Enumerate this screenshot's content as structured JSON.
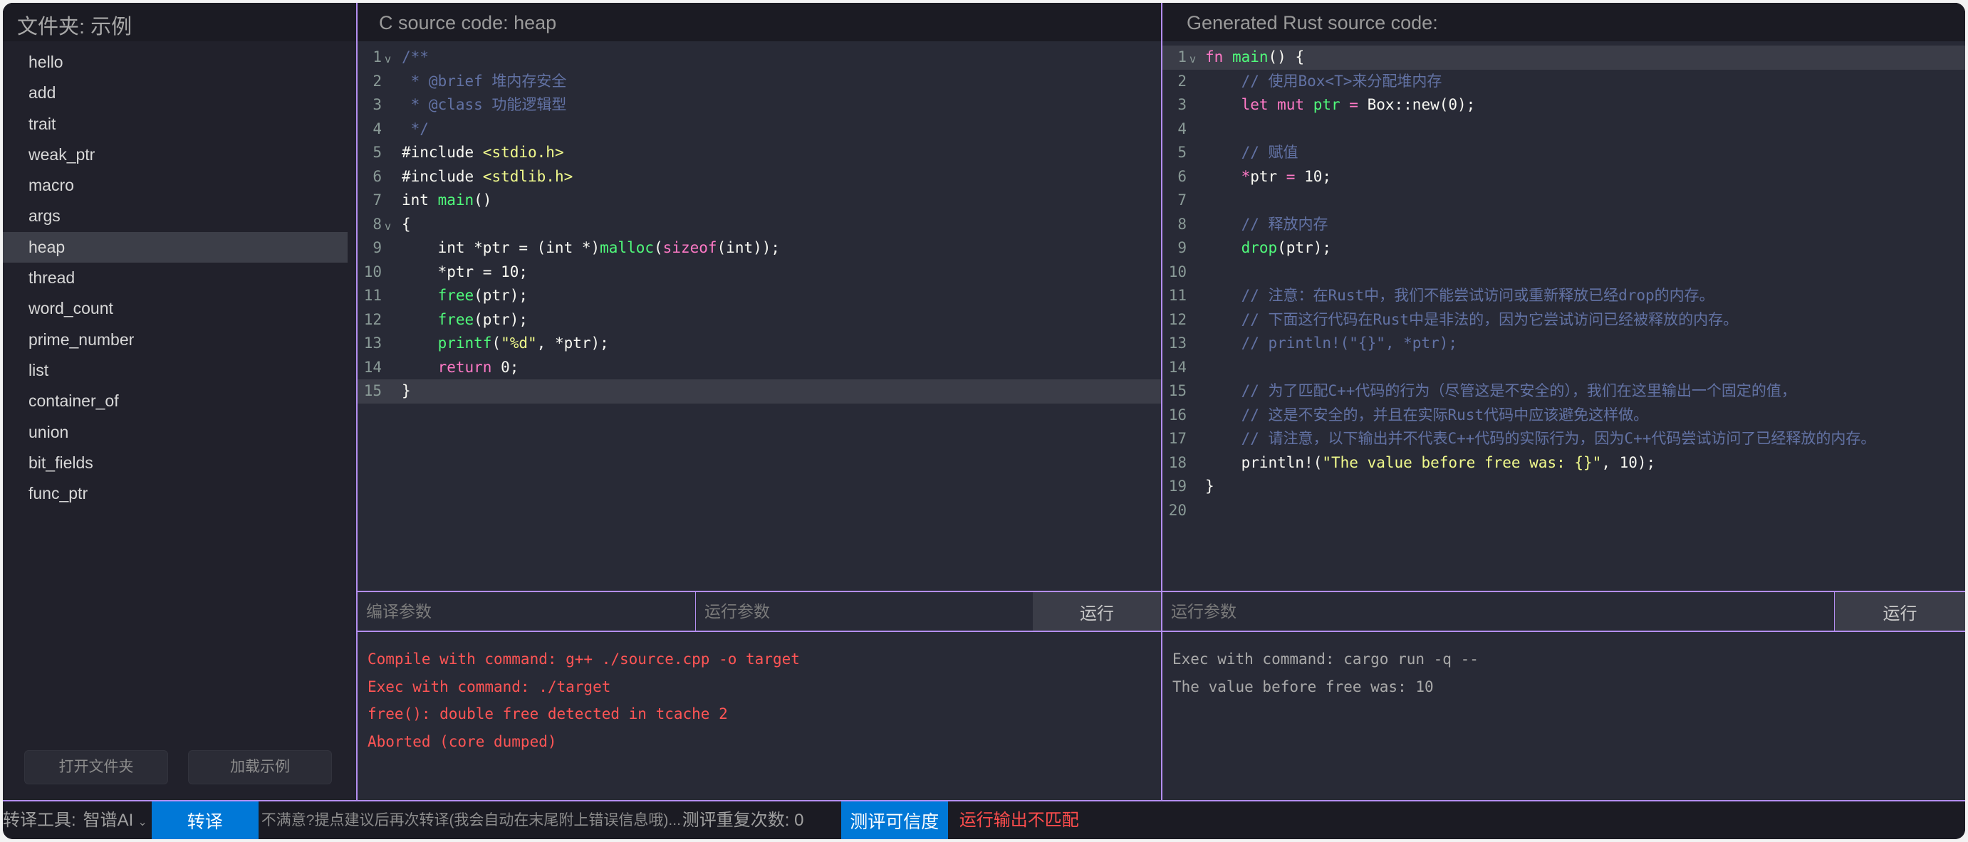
{
  "sidebar": {
    "title": "文件夹: 示例",
    "items": [
      {
        "label": "hello"
      },
      {
        "label": "add"
      },
      {
        "label": "trait"
      },
      {
        "label": "weak_ptr"
      },
      {
        "label": "macro"
      },
      {
        "label": "args"
      },
      {
        "label": "heap",
        "active": true
      },
      {
        "label": "thread"
      },
      {
        "label": "word_count"
      },
      {
        "label": "prime_number"
      },
      {
        "label": "list"
      },
      {
        "label": "container_of"
      },
      {
        "label": "union"
      },
      {
        "label": "bit_fields"
      },
      {
        "label": "func_ptr"
      }
    ],
    "open_folder_label": "打开文件夹",
    "load_example_label": "加载示例"
  },
  "c_panel": {
    "title": "C source code: heap",
    "lines": [
      [
        [
          "cm",
          "/**"
        ]
      ],
      [
        [
          "cm",
          " * @brief 堆内存安全"
        ]
      ],
      [
        [
          "cm",
          " * @class 功能逻辑型"
        ]
      ],
      [
        [
          "cm",
          " */"
        ]
      ],
      [
        [
          "",
          "#include "
        ],
        [
          "st",
          "<stdio.h>"
        ]
      ],
      [
        [
          "",
          "#include "
        ],
        [
          "st",
          "<stdlib.h>"
        ]
      ],
      [
        [
          "",
          "int "
        ],
        [
          "fn",
          "main"
        ],
        [
          "",
          "()"
        ]
      ],
      [
        [
          "",
          "{"
        ]
      ],
      [
        [
          "",
          "    int *ptr = (int *)"
        ],
        [
          "fn",
          "malloc"
        ],
        [
          "",
          "("
        ],
        [
          "kw",
          "sizeof"
        ],
        [
          "",
          "(int));"
        ]
      ],
      [
        [
          "",
          "    *ptr = 10;"
        ]
      ],
      [
        [
          "",
          "    "
        ],
        [
          "fn",
          "free"
        ],
        [
          "",
          "(ptr);"
        ]
      ],
      [
        [
          "",
          "    "
        ],
        [
          "fn",
          "free"
        ],
        [
          "",
          "(ptr);"
        ]
      ],
      [
        [
          "",
          "    "
        ],
        [
          "fn",
          "printf"
        ],
        [
          "",
          "("
        ],
        [
          "st",
          "\"%d\""
        ],
        [
          "",
          ", *ptr);"
        ]
      ],
      [
        [
          "",
          "    "
        ],
        [
          "kw",
          "return"
        ],
        [
          "",
          " 0;"
        ]
      ],
      [
        [
          "",
          "}"
        ]
      ]
    ],
    "fold_lines": [
      1,
      8
    ],
    "highlight_line": 15,
    "compile_params_placeholder": "编译参数",
    "run_params_placeholder": "运行参数",
    "run_label": "运行",
    "output": [
      "Compile with command: g++ ./source.cpp -o target",
      "Exec with command: ./target",
      "free(): double free detected in tcache 2",
      "Aborted (core dumped)"
    ],
    "output_status": "error"
  },
  "rust_panel": {
    "title": "Generated Rust source code:",
    "lines": [
      [
        [
          "kw",
          "fn "
        ],
        [
          "fn",
          "main"
        ],
        [
          "",
          "() {"
        ]
      ],
      [
        [
          "cm",
          "    // 使用Box<T>来分配堆内存"
        ]
      ],
      [
        [
          "kw",
          "    let mut "
        ],
        [
          "fn",
          "ptr"
        ],
        [
          "kw",
          " = "
        ],
        [
          "",
          "Box::new(0);"
        ]
      ],
      [],
      [
        [
          "cm",
          "    // 赋值"
        ]
      ],
      [
        [
          "kw",
          "    *"
        ],
        [
          "",
          "ptr "
        ],
        [
          "kw",
          "="
        ],
        [
          "",
          " 10;"
        ]
      ],
      [],
      [
        [
          "cm",
          "    // 释放内存"
        ]
      ],
      [
        [
          "fn",
          "    drop"
        ],
        [
          "",
          "(ptr);"
        ]
      ],
      [],
      [
        [
          "cm",
          "    // 注意：在Rust中，我们不能尝试访问或重新释放已经drop的内存。"
        ]
      ],
      [
        [
          "cm",
          "    // 下面这行代码在Rust中是非法的，因为它尝试访问已经被释放的内存。"
        ]
      ],
      [
        [
          "cm",
          "    // println!(\"{}\", *ptr);"
        ]
      ],
      [],
      [
        [
          "cm",
          "    // 为了匹配C++代码的行为（尽管这是不安全的），我们在这里输出一个固定的值，"
        ]
      ],
      [
        [
          "cm",
          "    // 这是不安全的，并且在实际Rust代码中应该避免这样做。"
        ]
      ],
      [
        [
          "cm",
          "    // 请注意，以下输出并不代表C++代码的实际行为，因为C++代码尝试访问了已经释放的内存。"
        ]
      ],
      [
        [
          "",
          "    println!("
        ],
        [
          "st",
          "\"The value before free was: {}\""
        ],
        [
          "",
          ", 10);"
        ]
      ],
      [
        [
          "",
          "}"
        ]
      ],
      []
    ],
    "fold_lines": [
      1
    ],
    "highlight_line": 1,
    "run_params_placeholder": "运行参数",
    "run_label": "运行",
    "output": [
      "Exec with command: cargo run -q --",
      "The value before free was: 10"
    ],
    "output_status": "ok"
  },
  "bottombar": {
    "tool_label": "转译工具:",
    "tool_value": "智谱AI",
    "translate_label": "转译",
    "feedback_placeholder": "不满意?提点建议后再次转译(我会自动在末尾附上错误信息哦)....",
    "repeat_label": "测评重复次数: 0",
    "evaluate_label": "测评可信度",
    "status_text": "运行输出不匹配",
    "accent_color": "#0078d7",
    "status_color": "#ff4d4d"
  }
}
